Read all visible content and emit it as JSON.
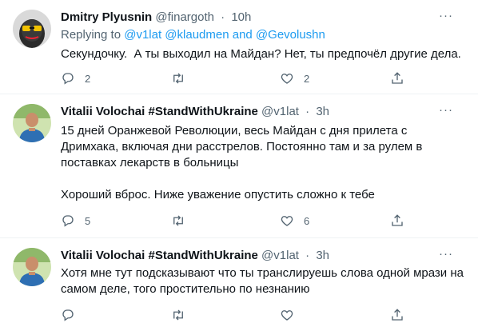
{
  "tweets": [
    {
      "name": "Dmitry Plyusnin",
      "handle": "@finargoth",
      "separator": "·",
      "time": "10h",
      "replying_prefix": "Replying to ",
      "replying_users": "@v1lat @klaudmen and @Gevolushn",
      "text": "Секундочку.  А ты выходил на Майдан? Нет, ты предпочёл другие дела.",
      "replies": "2",
      "retweets": "",
      "likes": "2"
    },
    {
      "name": "Vitalii Volochai #StandWithUkraine",
      "handle": "@v1lat",
      "separator": "·",
      "time": "3h",
      "text": "15 дней Оранжевой Революции, весь Майдан с дня прилета с\nДримхака, включая дни расстрелов. Постоянно там и за рулем в\nпоставках лекарств в больницы\n\nХороший вброс. Ниже уважение опустить сложно к тебе",
      "replies": "5",
      "retweets": "",
      "likes": "6"
    },
    {
      "name": "Vitalii Volochai #StandWithUkraine",
      "handle": "@v1lat",
      "separator": "·",
      "time": "3h",
      "text": "Хотя мне тут подсказывают что ты транслируешь слова одной мрази на\nсамом деле, того простительно по незнанию",
      "replies": "",
      "retweets": "",
      "likes": ""
    }
  ],
  "icons": {
    "more": "more-icon",
    "reply": "reply-icon",
    "retweet": "retweet-icon",
    "like": "like-icon",
    "share": "share-icon"
  },
  "colors": {
    "link": "#1d9bf0",
    "secondary": "#536471",
    "divider": "#eff3f4"
  }
}
